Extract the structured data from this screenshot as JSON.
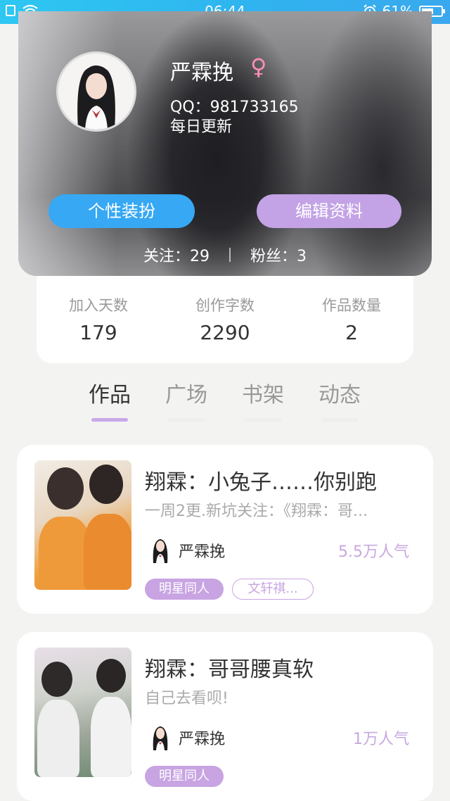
{
  "status_bar": {
    "time": "06:44",
    "battery": "61%",
    "battery_level": 0.61,
    "icons": [
      "sim-icon",
      "wifi-icon",
      "alarm-icon",
      "battery-icon"
    ]
  },
  "profile": {
    "name": "严霖挽",
    "gender_symbol": "♀",
    "qq": "QQ：981733165",
    "bio": "每日更新",
    "dress_button": "个性装扮",
    "edit_button": "编辑资料",
    "following": "关注：29",
    "followers": "粉丝：3"
  },
  "stats": [
    {
      "label": "加入天数",
      "value": "179"
    },
    {
      "label": "创作字数",
      "value": "2290"
    },
    {
      "label": "作品数量",
      "value": "2"
    }
  ],
  "tabs": [
    {
      "label": "作品",
      "active": true
    },
    {
      "label": "广场",
      "active": false
    },
    {
      "label": "书架",
      "active": false
    },
    {
      "label": "动态",
      "active": false
    }
  ],
  "books": [
    {
      "title": "翔霖：小兔子……你别跑",
      "desc": "一周2更.新坑关注：《翔霖：哥...",
      "author": "严霖挽",
      "popularity": "5.5万人气",
      "tags": [
        "明星同人",
        "文轩祺..."
      ]
    },
    {
      "title": "翔霖：哥哥腰真软",
      "desc": "自己去看呗!",
      "author": "严霖挽",
      "popularity": "1万人气",
      "tags": [
        "明星同人"
      ]
    }
  ],
  "colors": {
    "status_bar": "#2fb4ef",
    "dress_button": "#36a8f4",
    "edit_button": "#c3a2e6",
    "accent_purple": "#c8a4e2",
    "gender": "#ff8fb0"
  }
}
